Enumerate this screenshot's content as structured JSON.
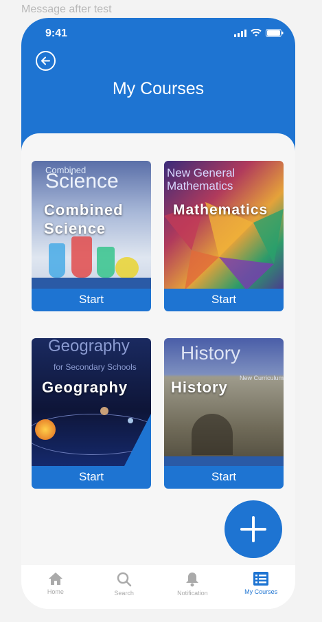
{
  "frame_label": "Message after test",
  "status": {
    "time": "9:41"
  },
  "header": {
    "title": "My Courses"
  },
  "courses": [
    {
      "name": "Combined\nScience",
      "action": "Start",
      "book_title": "Science",
      "book_sub": "Combined"
    },
    {
      "name": "Mathematics",
      "action": "Start",
      "book_title": "Mathematics",
      "book_sub": "New General"
    },
    {
      "name": "Geography",
      "action": "Start",
      "book_title": "Geography",
      "book_sub": "for Secondary Schools"
    },
    {
      "name": "History",
      "action": "Start",
      "book_title": "History",
      "book_sub": "New Curriculum"
    }
  ],
  "nav": [
    {
      "label": "Home",
      "icon": "home-icon"
    },
    {
      "label": "Search",
      "icon": "search-icon"
    },
    {
      "label": "Notification",
      "icon": "bell-icon"
    },
    {
      "label": "My Courses",
      "icon": "list-icon",
      "active": true
    }
  ],
  "colors": {
    "primary": "#1e74d2",
    "background": "#f6f6f6"
  }
}
